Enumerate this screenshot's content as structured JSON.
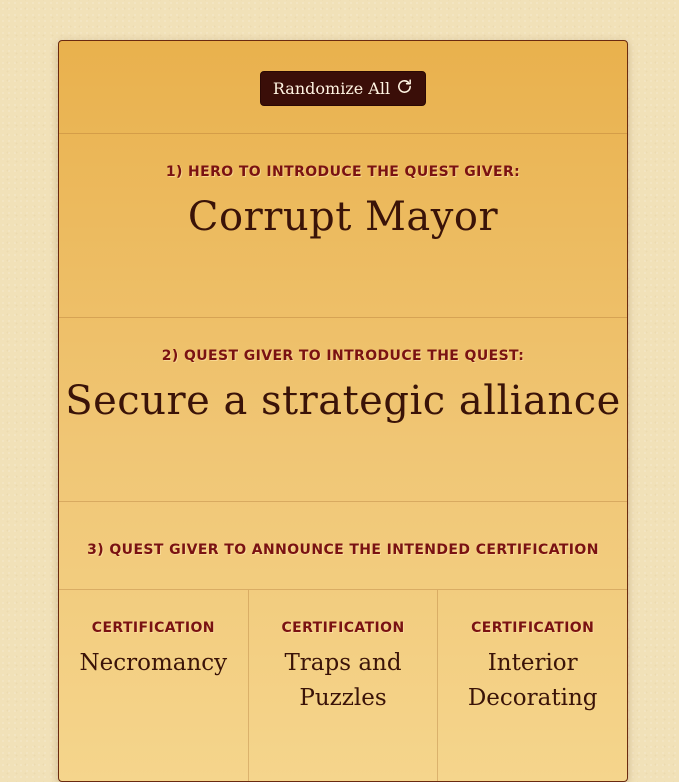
{
  "toolbar": {
    "randomize_label": "Randomize All",
    "randomize_icon": "refresh-icon"
  },
  "sections": [
    {
      "heading": "1) Hero to introduce the quest giver:",
      "value": "Corrupt Mayor"
    },
    {
      "heading": "2) Quest giver to introduce the quest:",
      "value": "Secure a strategic alliance"
    },
    {
      "heading": "3) Quest giver to announce the intended certification"
    }
  ],
  "certifications": [
    {
      "label": "Certification",
      "value": "Necromancy"
    },
    {
      "label": "Certification",
      "value": "Traps and Puzzles"
    },
    {
      "label": "Certification",
      "value": "Interior Decorating"
    }
  ],
  "colors": {
    "background": "#f1e1b8",
    "card_top": "#e9b14d",
    "card_bottom": "#f5d58c",
    "heading": "#7a1212",
    "value_text": "#3a1308",
    "button_bg": "#3a0e08",
    "button_text": "#fff4e2"
  }
}
